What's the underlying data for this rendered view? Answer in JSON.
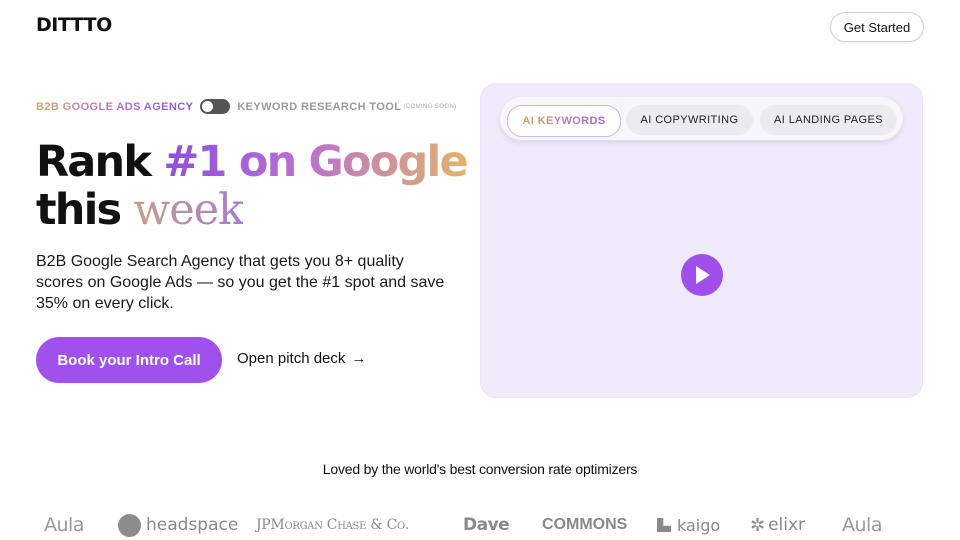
{
  "header": {
    "logo": "DITTTO",
    "cta": "Get Started"
  },
  "hero": {
    "agency_label": "B2B GOOGLE ADS AGENCY",
    "tool_label": "KEYWORD RESEARCH TOOL",
    "coming_soon": "(COMING SOON)",
    "title_part1": "Rank ",
    "title_highlight": "#1 on Google",
    "title_part2": "this ",
    "title_serif": "week",
    "description": "B2B Google Search Agency that gets you 8+ quality scores on Google Ads — so you get the #1 spot and save 35% on every click.",
    "primary_cta": "Book your Intro Call",
    "secondary_cta": "Open pitch deck",
    "arrow": "→"
  },
  "video": {
    "tabs": [
      "AI KEYWORDS",
      "AI COPYWRITING",
      "AI LANDING PAGES"
    ],
    "active_tab": "AI KEYWORDS"
  },
  "social_proof": {
    "heading": "Loved by the world's best conversion rate optimizers",
    "logos": [
      "Aula",
      "headspace",
      "JPMorgan Chase & Co.",
      "Dave",
      "COMMONS",
      "kaigo",
      "elixr",
      "Aula"
    ]
  },
  "colors": {
    "accent": "#a050ec",
    "panel_bg": "#f0eafd",
    "logo_gray": "#8a8a8a"
  }
}
